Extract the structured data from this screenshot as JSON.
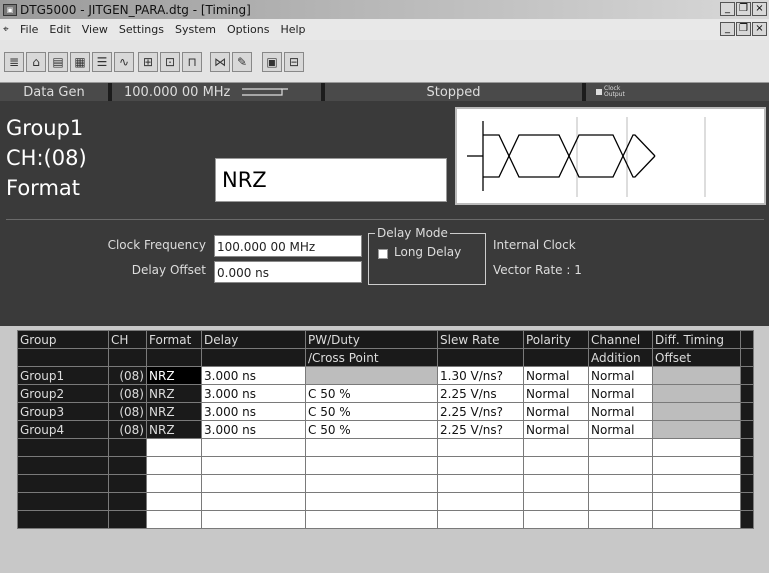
{
  "window": {
    "title": "DTG5000 - JITGEN_PARA.dtg - [Timing]",
    "title_icon": "app-icon"
  },
  "menu": {
    "items": [
      "File",
      "Edit",
      "View",
      "Settings",
      "System",
      "Options",
      "Help"
    ]
  },
  "status": {
    "mode": "Data Gen",
    "frequency": "100.000 00 MHz",
    "state": "Stopped",
    "clock_output": "Clock Output"
  },
  "panel": {
    "group": "Group1",
    "channel": "CH:(08)",
    "field_name": "Format",
    "format_value": "NRZ",
    "clock_frequency_label": "Clock Frequency",
    "clock_frequency_value": "100.000 00 MHz",
    "delay_offset_label": "Delay Offset",
    "delay_offset_value": "0.000 ns",
    "delay_mode_title": "Delay Mode",
    "long_delay_label": "Long Delay",
    "clock_source": "Internal Clock",
    "vector_rate": "Vector Rate : 1"
  },
  "table": {
    "headers1": [
      "Group",
      "CH",
      "Format",
      "Delay",
      "PW/Duty",
      "Slew Rate",
      "Polarity",
      "Channel",
      "Diff. Timing"
    ],
    "headers2": [
      "",
      "",
      "",
      "",
      "/Cross Point",
      "",
      "",
      "Addition",
      "Offset"
    ],
    "rows": [
      [
        "Group1",
        "(08)",
        "NRZ",
        "3.000 ns",
        "",
        "1.30 V/ns?",
        "Normal",
        "Normal",
        ""
      ],
      [
        "Group2",
        "(08)",
        "NRZ",
        "3.000 ns",
        "C 50 %",
        "2.25 V/ns",
        "Normal",
        "Normal",
        ""
      ],
      [
        "Group3",
        "(08)",
        "NRZ",
        "3.000 ns",
        "C 50 %",
        "2.25 V/ns?",
        "Normal",
        "Normal",
        ""
      ],
      [
        "Group4",
        "(08)",
        "NRZ",
        "3.000 ns",
        "C 50 %",
        "2.25 V/ns?",
        "Normal",
        "Normal",
        ""
      ]
    ]
  }
}
